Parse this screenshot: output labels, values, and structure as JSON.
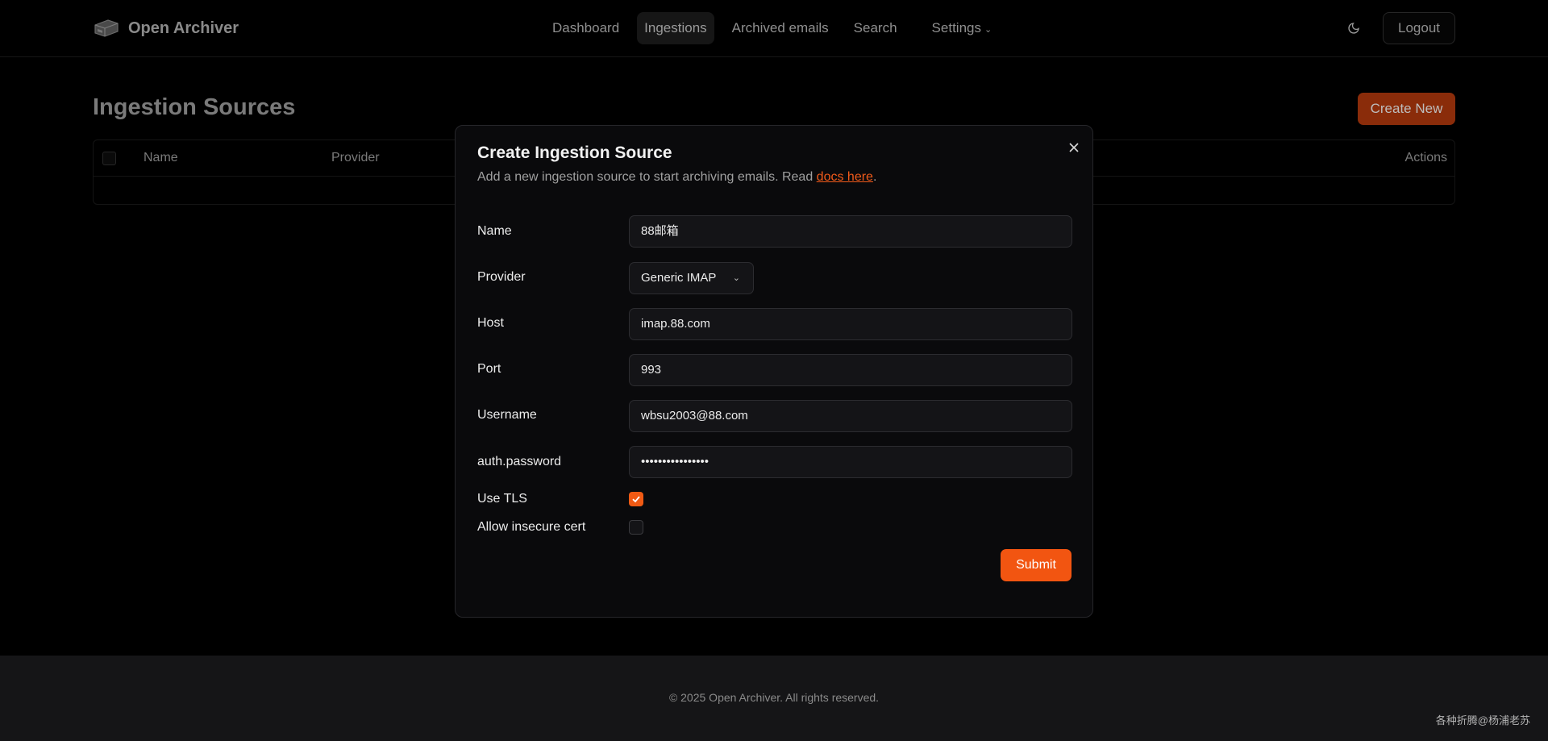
{
  "app": {
    "name": "Open Archiver"
  },
  "nav": {
    "items": [
      {
        "label": "Dashboard"
      },
      {
        "label": "Ingestions",
        "active": true
      },
      {
        "label": "Archived emails"
      },
      {
        "label": "Search"
      },
      {
        "label": "Settings"
      }
    ],
    "theme_icon": "moon-icon",
    "logout_label": "Logout"
  },
  "page": {
    "title": "Ingestion Sources",
    "create_label": "Create New",
    "table": {
      "columns": [
        "Name",
        "Provider",
        "Actions"
      ],
      "rows": []
    }
  },
  "modal": {
    "title": "Create Ingestion Source",
    "description": "Add a new ingestion source to start archiving emails. Read ",
    "docs_link": "docs here",
    "description_end": ".",
    "fields": {
      "name": {
        "label": "Name",
        "value": "88邮箱"
      },
      "provider": {
        "label": "Provider",
        "value": "Generic IMAP"
      },
      "host": {
        "label": "Host",
        "value": "imap.88.com"
      },
      "port": {
        "label": "Port",
        "value": "993"
      },
      "username": {
        "label": "Username",
        "value": "wbsu2003@88.com"
      },
      "password": {
        "label": "auth.password",
        "value": "••••••••••••••••"
      }
    },
    "use_tls": {
      "label": "Use TLS",
      "checked": true
    },
    "allow_insecure": {
      "label": "Allow insecure cert",
      "checked": false
    },
    "submit_label": "Submit"
  },
  "footer": {
    "copyright": "© 2025 Open Archiver. All rights reserved."
  },
  "watermark": "各种折腾@杨浦老苏",
  "colors": {
    "accent": "#f25511",
    "background": "#000000",
    "modal_bg": "#0a0a0c"
  }
}
